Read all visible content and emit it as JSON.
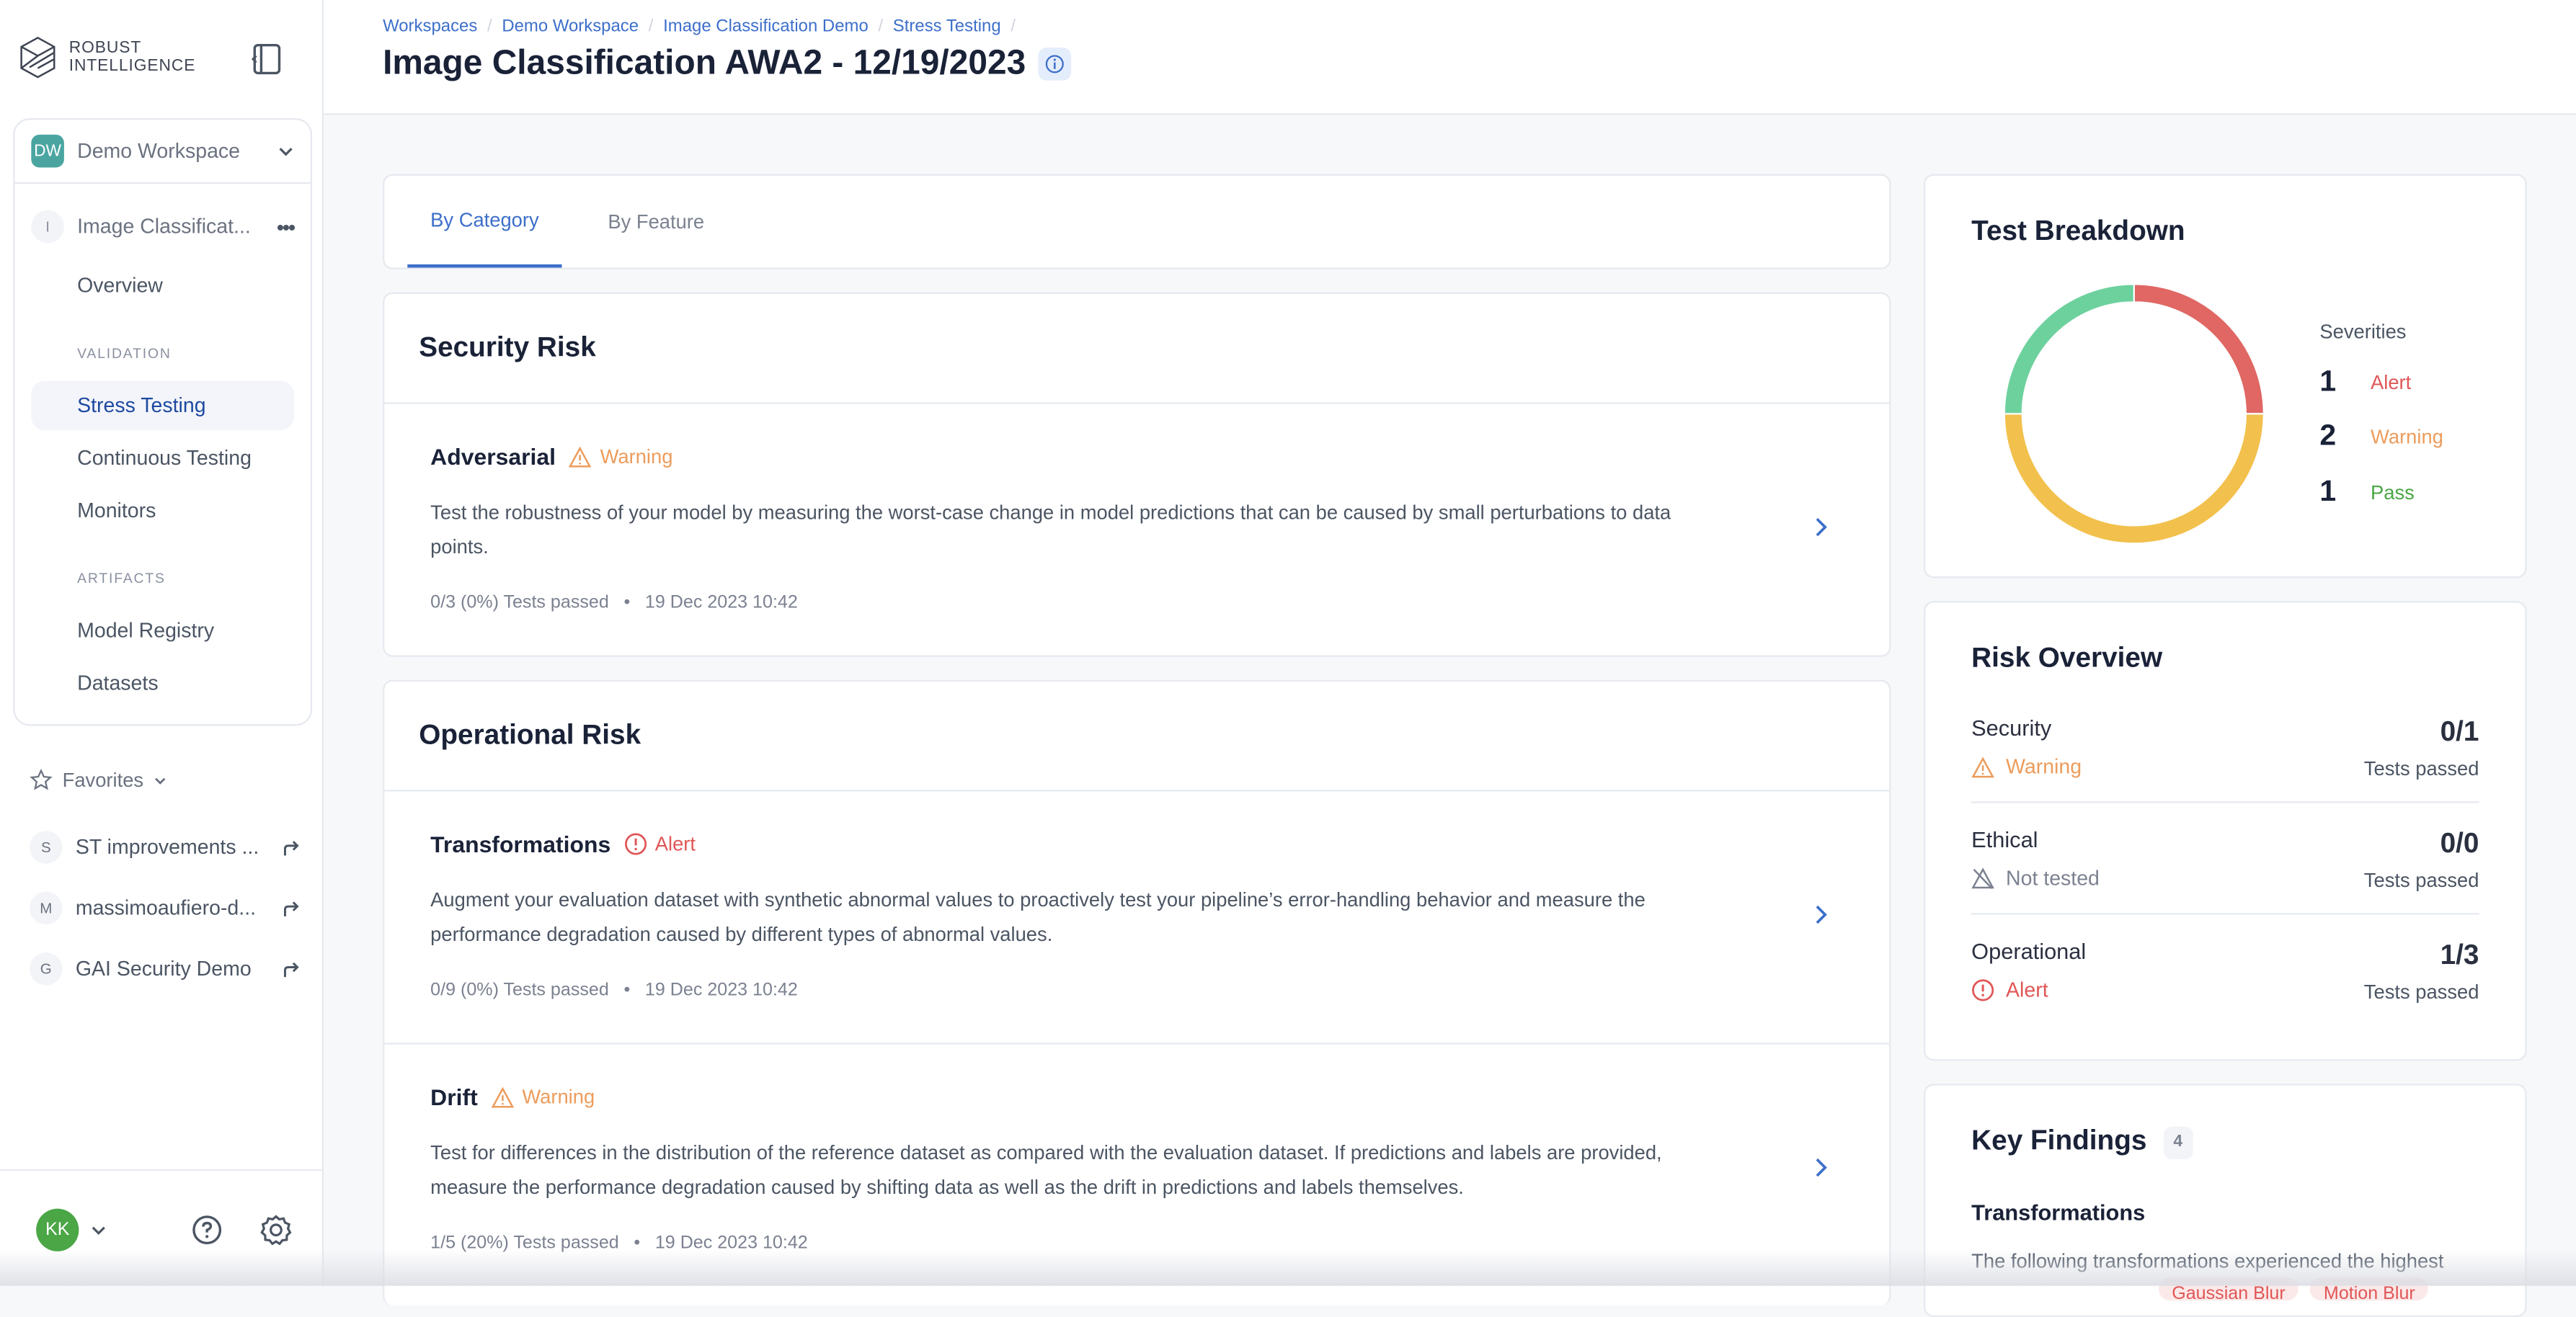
{
  "brand": {
    "line1": "ROBUST",
    "line2": "INTELLIGENCE"
  },
  "workspace": {
    "initials": "DW",
    "name": "Demo Workspace",
    "color": "#4aa5a1"
  },
  "project": {
    "initial": "I",
    "name": "Image Classificat..."
  },
  "nav": {
    "overview": "Overview",
    "validation_label": "VALIDATION",
    "validation_items": [
      "Stress Testing",
      "Continuous Testing",
      "Monitors"
    ],
    "artifacts_label": "ARTIFACTS",
    "artifacts_items": [
      "Model Registry",
      "Datasets"
    ],
    "active": "Stress Testing"
  },
  "favorites": {
    "label": "Favorites",
    "items": [
      {
        "initial": "S",
        "name": "ST improvements ..."
      },
      {
        "initial": "M",
        "name": "massimoaufiero-d..."
      },
      {
        "initial": "G",
        "name": "GAI Security Demo"
      }
    ]
  },
  "user": {
    "initials": "KK",
    "color": "#4ba646"
  },
  "breadcrumbs": [
    "Workspaces",
    "Demo Workspace",
    "Image Classification Demo",
    "Stress Testing"
  ],
  "page_title": "Image Classification AWA2 - 12/19/2023",
  "tabs": [
    {
      "label": "By Category",
      "active": true
    },
    {
      "label": "By Feature",
      "active": false
    }
  ],
  "sections": [
    {
      "title": "Security Risk",
      "tests": [
        {
          "name": "Adversarial",
          "status": "Warning",
          "description": "Test the robustness of your model by measuring the worst-case change in model predictions that can be caused by small perturbations to data points.",
          "passed": "0/3 (0%) Tests passed",
          "timestamp": "19 Dec 2023 10:42"
        }
      ]
    },
    {
      "title": "Operational Risk",
      "tests": [
        {
          "name": "Transformations",
          "status": "Alert",
          "description": "Augment your evaluation dataset with synthetic abnormal values to proactively test your pipeline’s error-handling behavior and measure the performance degradation caused by different types of abnormal values.",
          "passed": "0/9 (0%) Tests passed",
          "timestamp": "19 Dec 2023 10:42"
        },
        {
          "name": "Drift",
          "status": "Warning",
          "description": "Test for differences in the distribution of the reference dataset as compared with the evaluation dataset. If predictions and labels are provided, measure the performance degradation caused by shifting data as well as the drift in predictions and labels themselves.",
          "passed": "1/5 (20%) Tests passed",
          "timestamp": "19 Dec 2023 10:42"
        }
      ]
    }
  ],
  "meta_separator": "•",
  "test_breakdown": {
    "title": "Test Breakdown",
    "legend_title": "Severities",
    "severities": [
      {
        "count": 1,
        "label": "Alert",
        "color": "#e06763"
      },
      {
        "count": 2,
        "label": "Warning",
        "color": "#f2c04c",
        "text_color": "#ec9c5c"
      },
      {
        "count": 1,
        "label": "Pass",
        "color": "#6dd19e",
        "text_color": "#4ba646"
      }
    ]
  },
  "chart_data": {
    "type": "pie",
    "title": "Test Breakdown",
    "categories": [
      "Alert",
      "Warning",
      "Pass"
    ],
    "values": [
      1,
      2,
      1
    ],
    "donut": true,
    "legend": "right"
  },
  "risk_overview": {
    "title": "Risk Overview",
    "rows": [
      {
        "name": "Security",
        "status": "Warning",
        "score": "0/1",
        "sub": "Tests passed"
      },
      {
        "name": "Ethical",
        "status": "Not tested",
        "score": "0/0",
        "sub": "Tests passed"
      },
      {
        "name": "Operational",
        "status": "Alert",
        "score": "1/3",
        "sub": "Tests passed"
      }
    ]
  },
  "key_findings": {
    "title": "Key Findings",
    "count": "4",
    "subtitle": "Transformations",
    "text": "The following transformations experienced the highest",
    "tags": [
      "Gaussian Blur",
      "Motion Blur"
    ]
  },
  "colors": {
    "accent": "#3d6fca",
    "warning": "#ec9c5c",
    "alert": "#e05656",
    "pass": "#4ba646"
  }
}
